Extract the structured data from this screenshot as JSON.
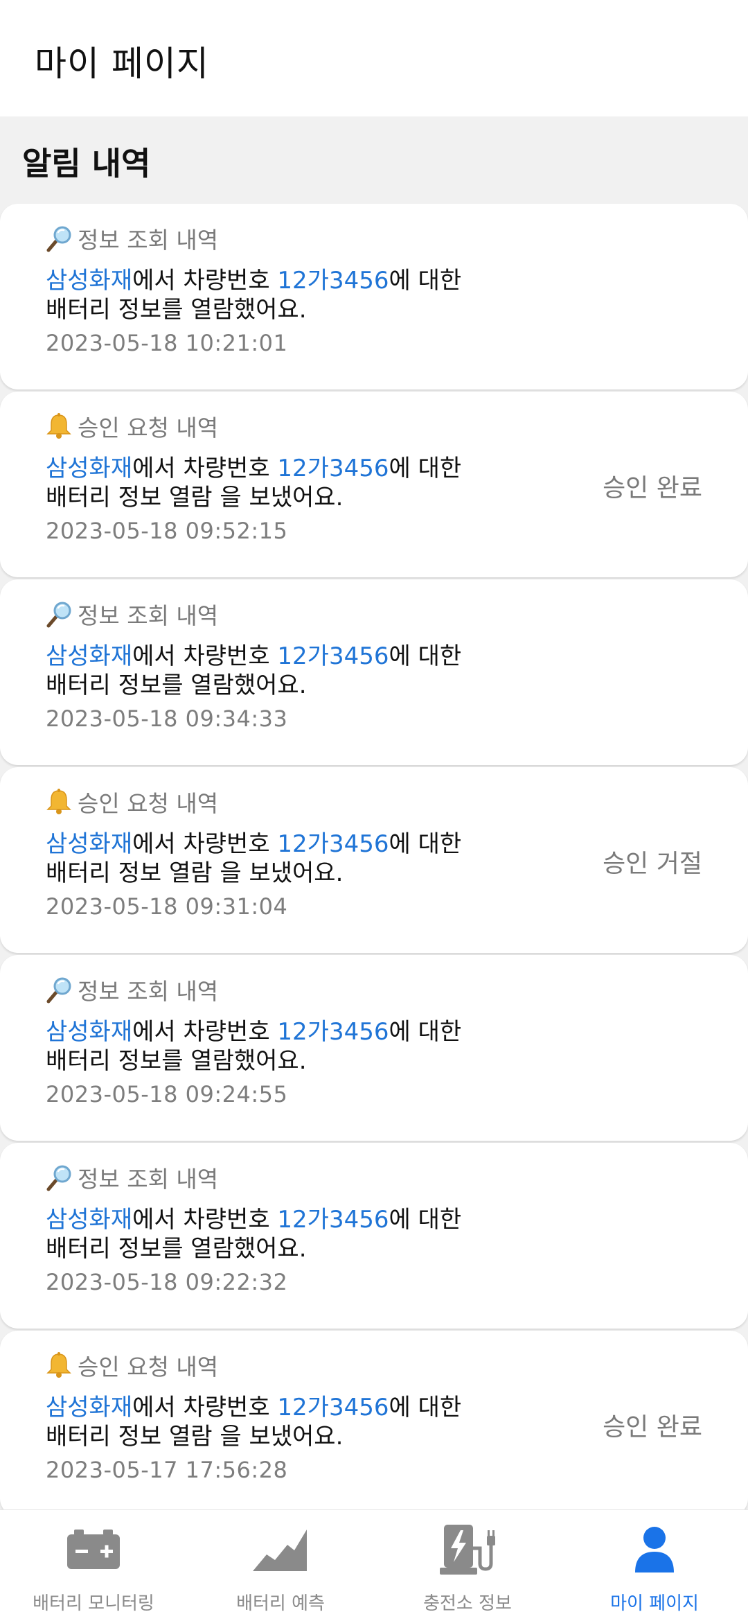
{
  "header": {
    "title": "마이 페이지"
  },
  "section": {
    "title": "알림 내역"
  },
  "notifications": [
    {
      "icon": "magnifier-icon",
      "type": "정보 조회 내역",
      "company": "삼성화재",
      "mid1": "에서 차량번호 ",
      "plate": "12가3456",
      "mid2": "에 대한",
      "line2": "배터리 정보를 열람했어요.",
      "time": "2023-05-18 10:21:01",
      "status": ""
    },
    {
      "icon": "bell-icon",
      "type": "승인 요청 내역",
      "company": "삼성화재",
      "mid1": "에서 차량번호 ",
      "plate": "12가3456",
      "mid2": "에 대한",
      "line2": "배터리 정보 열람 을 보냈어요.",
      "time": "2023-05-18 09:52:15",
      "status": "승인 완료"
    },
    {
      "icon": "magnifier-icon",
      "type": "정보 조회 내역",
      "company": "삼성화재",
      "mid1": "에서 차량번호 ",
      "plate": "12가3456",
      "mid2": "에 대한",
      "line2": "배터리 정보를 열람했어요.",
      "time": "2023-05-18 09:34:33",
      "status": ""
    },
    {
      "icon": "bell-icon",
      "type": "승인 요청 내역",
      "company": "삼성화재",
      "mid1": "에서 차량번호 ",
      "plate": "12가3456",
      "mid2": "에 대한",
      "line2": "배터리 정보 열람 을 보냈어요.",
      "time": "2023-05-18 09:31:04",
      "status": "승인 거절"
    },
    {
      "icon": "magnifier-icon",
      "type": "정보 조회 내역",
      "company": "삼성화재",
      "mid1": "에서 차량번호 ",
      "plate": "12가3456",
      "mid2": "에 대한",
      "line2": "배터리 정보를 열람했어요.",
      "time": "2023-05-18 09:24:55",
      "status": ""
    },
    {
      "icon": "magnifier-icon",
      "type": "정보 조회 내역",
      "company": "삼성화재",
      "mid1": "에서 차량번호 ",
      "plate": "12가3456",
      "mid2": "에 대한",
      "line2": "배터리 정보를 열람했어요.",
      "time": "2023-05-18 09:22:32",
      "status": ""
    },
    {
      "icon": "bell-icon",
      "type": "승인 요청 내역",
      "company": "삼성화재",
      "mid1": "에서 차량번호 ",
      "plate": "12가3456",
      "mid2": "에 대한",
      "line2": "배터리 정보 열람 을 보냈어요.",
      "time": "2023-05-17 17:56:28",
      "status": "승인 완료"
    }
  ],
  "nav": {
    "items": [
      {
        "label": "배터리 모니터링",
        "icon": "battery-icon",
        "active": false
      },
      {
        "label": "배터리 예측",
        "icon": "area-chart-icon",
        "active": false
      },
      {
        "label": "충전소 정보",
        "icon": "charging-station-icon",
        "active": false
      },
      {
        "label": "마이 페이지",
        "icon": "person-icon",
        "active": true
      }
    ]
  },
  "colors": {
    "accent": "#1a73e8",
    "highlight_text": "#1f74d6",
    "muted_text": "#7a7a7a",
    "background": "#f1f1f1",
    "nav_icon_inactive": "#8a8a8a"
  }
}
